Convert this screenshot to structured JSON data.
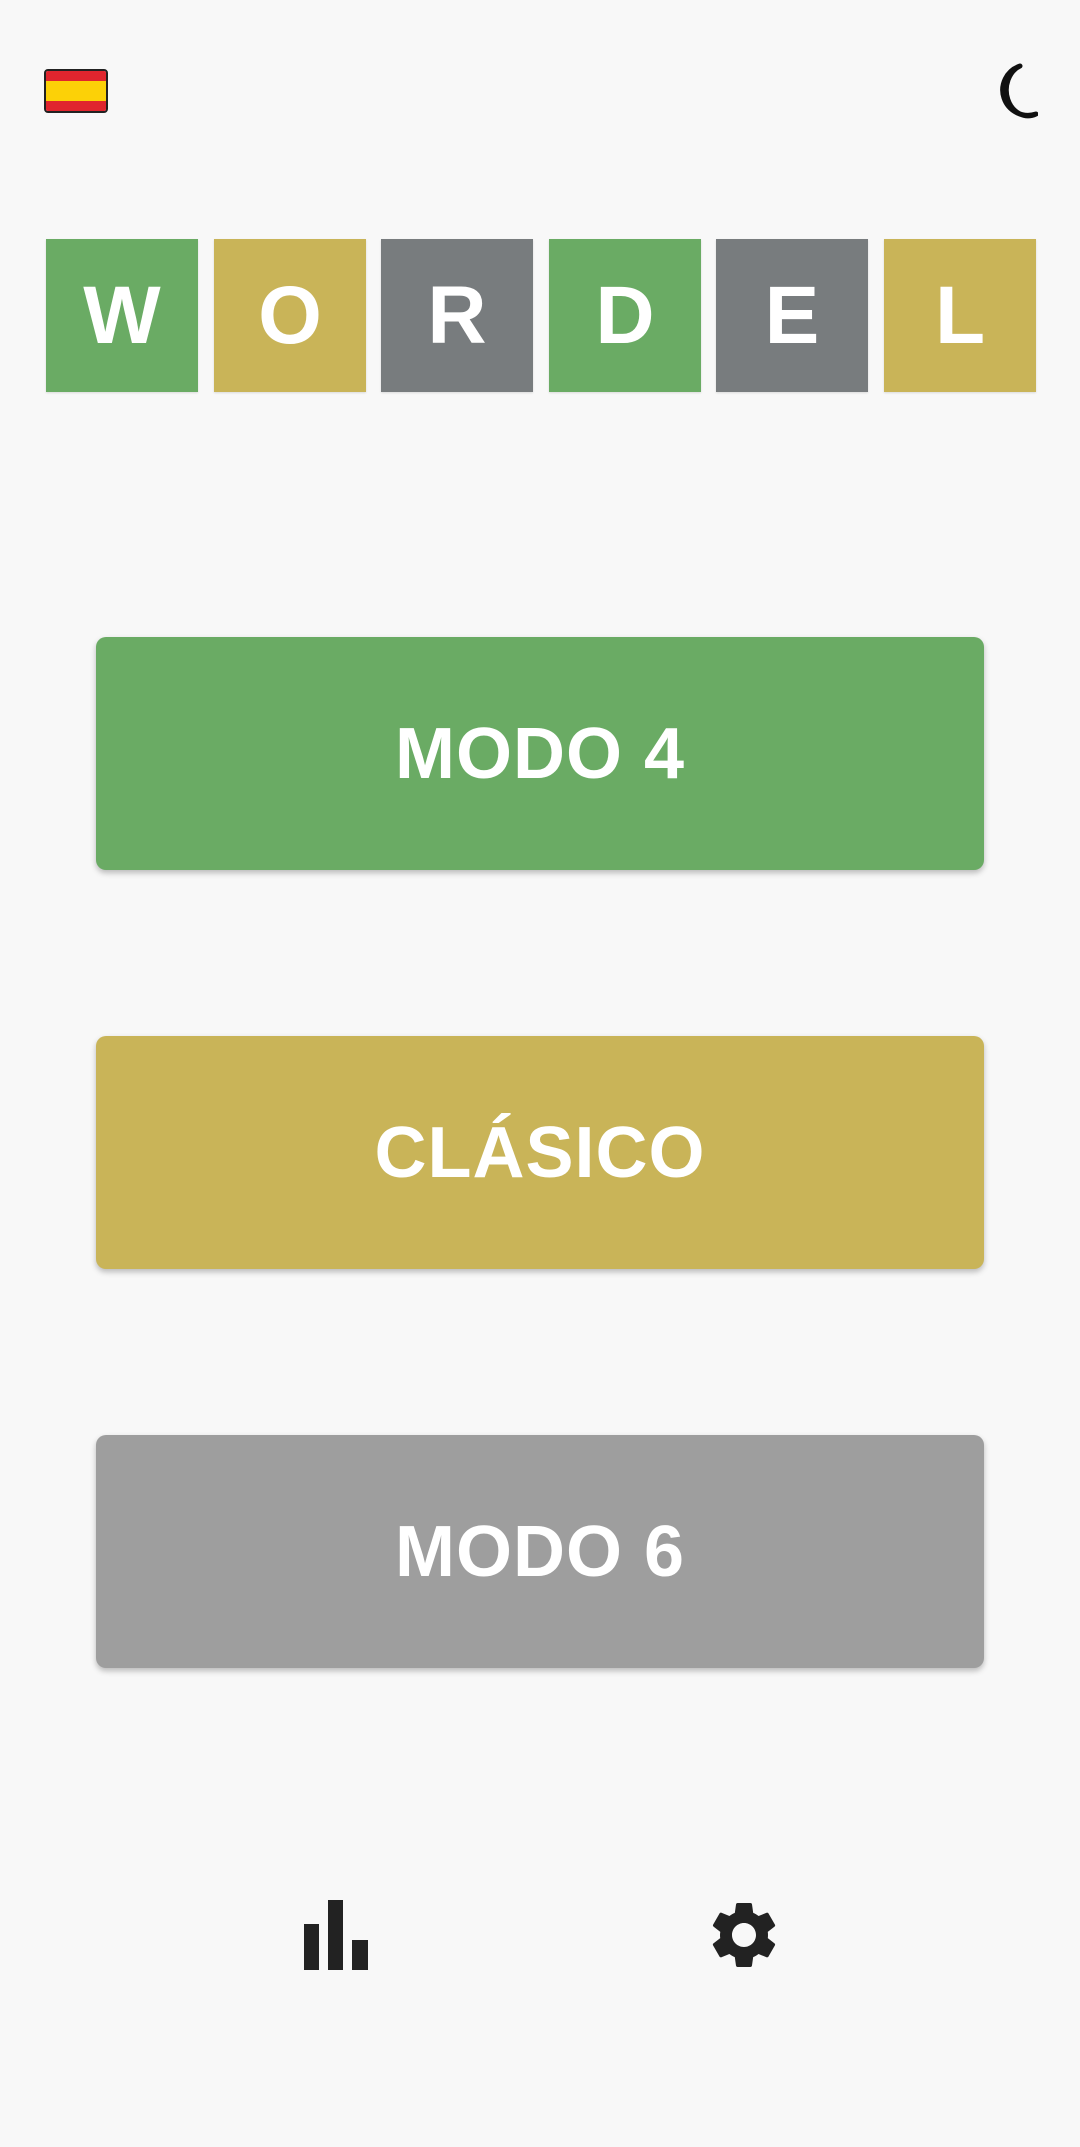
{
  "header": {
    "language_flag_icon": "spain-flag-icon",
    "theme_toggle_icon": "moon-icon",
    "flag_colors": {
      "red": "#e0252e",
      "yellow": "#fcd107"
    }
  },
  "title_tiles": [
    {
      "letter": "W",
      "color": "#6aab64"
    },
    {
      "letter": "O",
      "color": "#c9b458"
    },
    {
      "letter": "R",
      "color": "#787c7e"
    },
    {
      "letter": "D",
      "color": "#6aab64"
    },
    {
      "letter": "E",
      "color": "#787c7e"
    },
    {
      "letter": "L",
      "color": "#c9b458"
    }
  ],
  "modes": [
    {
      "label": "MODO 4",
      "color": "#6aab64"
    },
    {
      "label": "CLÁSICO",
      "color": "#c9b458"
    },
    {
      "label": "MODO 6",
      "color": "#9e9e9e"
    }
  ],
  "bottom_bar": {
    "stats_icon": "bar-chart-icon",
    "settings_icon": "gear-icon",
    "icon_color": "#222222"
  }
}
